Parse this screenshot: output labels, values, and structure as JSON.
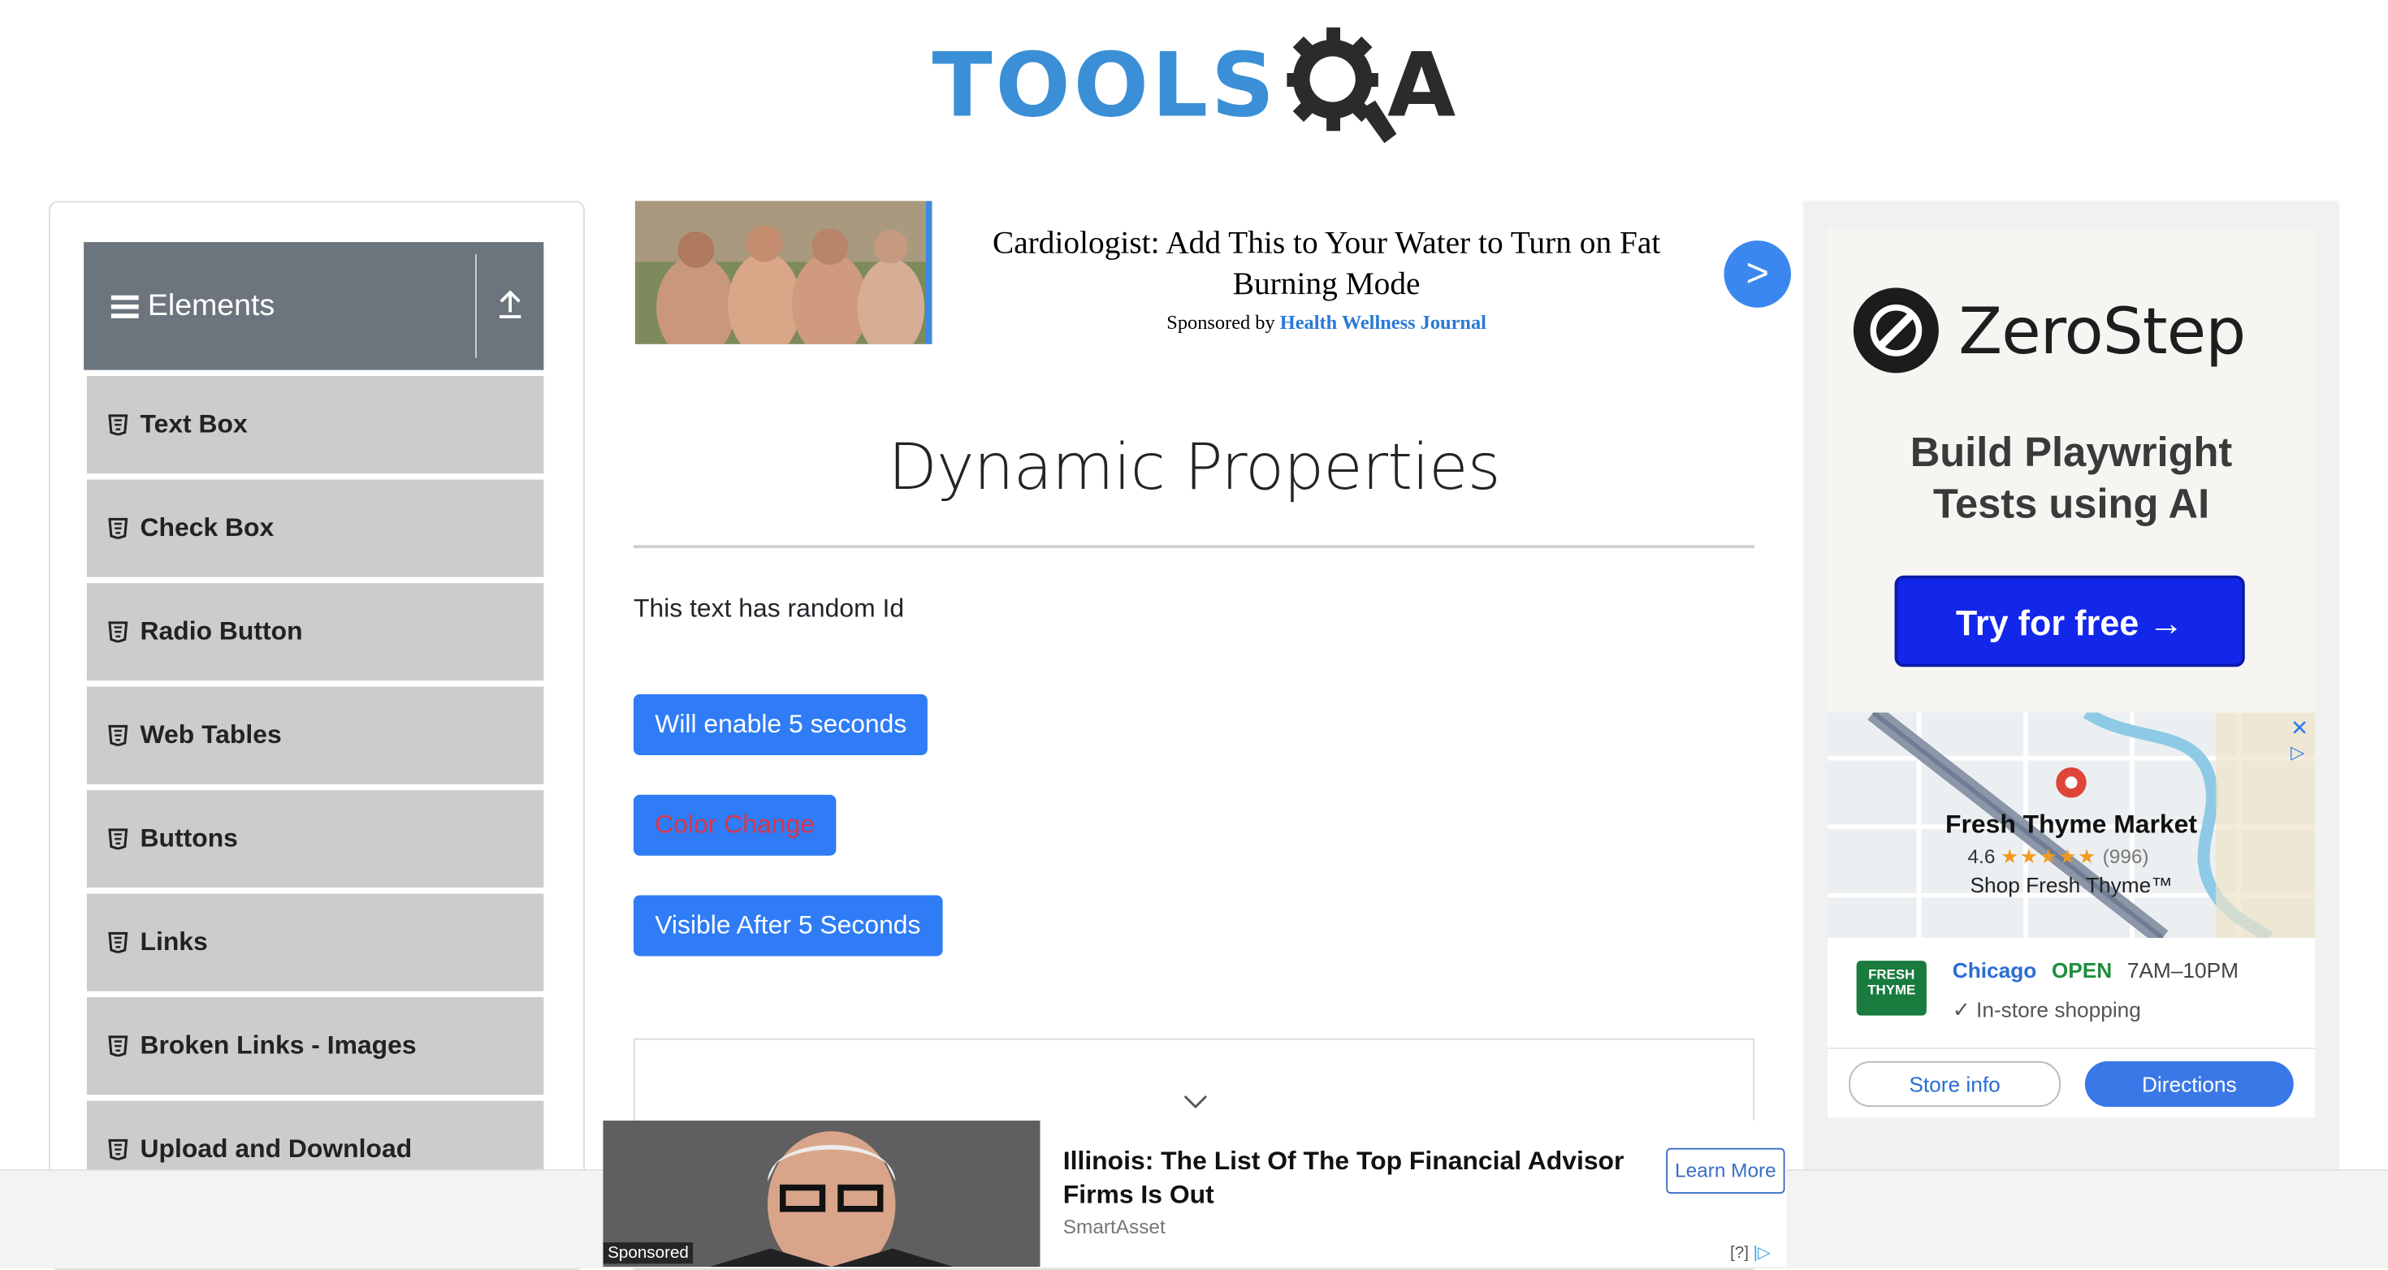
{
  "brand": {
    "logo_text": "TOOLS",
    "logo_suffix": "A"
  },
  "sidebar": {
    "group_title": "Elements",
    "items": [
      {
        "label": "Text Box"
      },
      {
        "label": "Check Box"
      },
      {
        "label": "Radio Button"
      },
      {
        "label": "Web Tables"
      },
      {
        "label": "Buttons"
      },
      {
        "label": "Links"
      },
      {
        "label": "Broken Links - Images"
      },
      {
        "label": "Upload and Download"
      }
    ]
  },
  "top_ad": {
    "headline": "Cardiologist: Add This to Your Water to Turn on Fat Burning Mode",
    "sponsored_prefix": "Sponsored by",
    "sponsor": "Health Wellness Journal",
    "next_glyph": ">"
  },
  "main": {
    "title": "Dynamic Properties",
    "random_text": "This text has random Id",
    "buttons": {
      "enable_after": "Will enable 5 seconds",
      "color_change": "Color Change",
      "visible_after": "Visible After 5 Seconds"
    }
  },
  "right_ad": {
    "brand": "ZeroStep",
    "tagline_1": "Build Playwright",
    "tagline_2": "Tests using AI",
    "cta": "Try for free →",
    "store": {
      "name": "Fresh Thyme Market",
      "rating": "4.6",
      "stars": "★★★★★",
      "review_count": "(996)",
      "shop_text": "Shop Fresh Thyme™",
      "logo_text": "FRESH THYME",
      "city": "Chicago",
      "status": "OPEN",
      "hours": "7AM–10PM",
      "instore": "✓ In-store shopping",
      "store_info_label": "Store info",
      "directions_label": "Directions"
    }
  },
  "bottom_ad": {
    "title": "Illinois: The List Of The Top Financial Advisor Firms Is Out",
    "source": "SmartAsset",
    "learn_more": "Learn More",
    "sponsored_tag": "Sponsored",
    "adchoice": "[?]"
  },
  "colors": {
    "primary_button": "#2f7cf6",
    "sidebar_header": "#6c757d",
    "menu_item": "#cccccc",
    "logo_blue": "#3a8fd6",
    "zerostep_cta": "#1227ea"
  }
}
